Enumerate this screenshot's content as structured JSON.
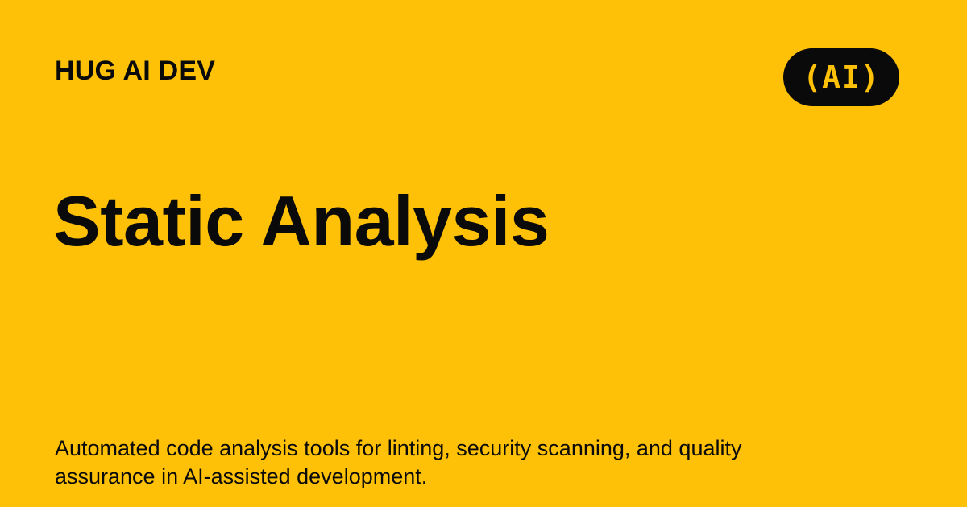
{
  "brand": {
    "name": "HUG AI DEV",
    "logo_text": "(AI)"
  },
  "hero": {
    "title": "Static Analysis",
    "description": "Automated code analysis tools for linting, security scanning, and quality assurance in AI-assisted development."
  },
  "colors": {
    "background": "#FFC107",
    "text": "#0a0a0a",
    "badge_background": "#0a0a0a",
    "badge_text": "#FFC107"
  },
  "icons": {
    "logo": "ai-logo-badge"
  }
}
